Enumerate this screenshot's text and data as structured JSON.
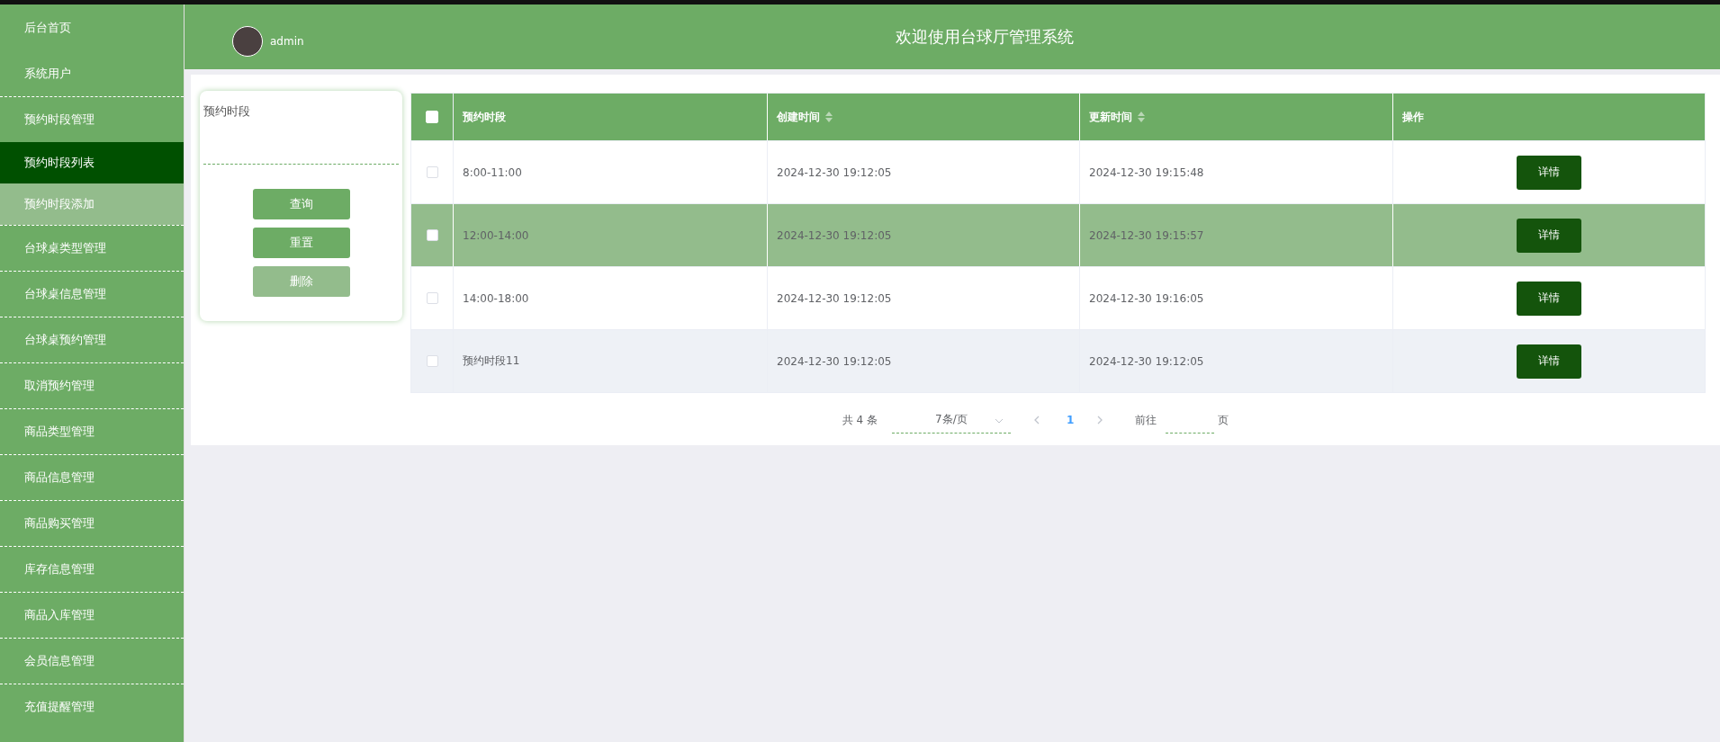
{
  "sidebar": {
    "items": [
      {
        "label": "后台首页",
        "selected": false,
        "hovered": false
      },
      {
        "label": "系统用户",
        "selected": false,
        "hovered": false
      },
      {
        "label": "预约时段管理",
        "selected": false,
        "hovered": false,
        "children": [
          {
            "label": "预约时段列表",
            "selected": true,
            "hovered": false
          },
          {
            "label": "预约时段添加",
            "selected": false,
            "hovered": true
          }
        ]
      },
      {
        "label": "台球桌类型管理",
        "selected": false,
        "hovered": false
      },
      {
        "label": "台球桌信息管理",
        "selected": false,
        "hovered": false
      },
      {
        "label": "台球桌预约管理",
        "selected": false,
        "hovered": false
      },
      {
        "label": "取消预约管理",
        "selected": false,
        "hovered": false
      },
      {
        "label": "商品类型管理",
        "selected": false,
        "hovered": false
      },
      {
        "label": "商品信息管理",
        "selected": false,
        "hovered": false
      },
      {
        "label": "商品购买管理",
        "selected": false,
        "hovered": false
      },
      {
        "label": "库存信息管理",
        "selected": false,
        "hovered": false
      },
      {
        "label": "商品入库管理",
        "selected": false,
        "hovered": false
      },
      {
        "label": "会员信息管理",
        "selected": false,
        "hovered": false
      },
      {
        "label": "充值提醒管理",
        "selected": false,
        "hovered": false
      }
    ]
  },
  "header": {
    "username": "admin",
    "title": "欢迎使用台球厅管理系统"
  },
  "search": {
    "label": "预约时段",
    "buttons": [
      {
        "label": "查询",
        "disabled": false
      },
      {
        "label": "重置",
        "disabled": false
      },
      {
        "label": "删除",
        "disabled": true
      }
    ]
  },
  "table": {
    "select_all": {
      "checked": false
    },
    "columns": [
      {
        "label": "预约时段",
        "kind": "plain"
      },
      {
        "label": "创建时间",
        "kind": "sortable"
      },
      {
        "label": "更新时间",
        "kind": "sortable"
      },
      {
        "label": "操作",
        "kind": "plain"
      }
    ],
    "rows": [
      {
        "checked": false,
        "selected": false,
        "hovered": false,
        "cells": [
          "8:00-11:00",
          "2024-12-30 19:12:05",
          "2024-12-30 19:15:48"
        ],
        "action": "详情"
      },
      {
        "checked": false,
        "selected": true,
        "hovered": false,
        "cells": [
          "12:00-14:00",
          "2024-12-30 19:12:05",
          "2024-12-30 19:15:57"
        ],
        "action": "详情"
      },
      {
        "checked": false,
        "selected": false,
        "hovered": false,
        "cells": [
          "14:00-18:00",
          "2024-12-30 19:12:05",
          "2024-12-30 19:16:05"
        ],
        "action": "详情"
      },
      {
        "checked": false,
        "selected": false,
        "hovered": true,
        "cells": [
          "预约时段11",
          "2024-12-30 19:12:05",
          "2024-12-30 19:12:05"
        ],
        "action": "详情"
      }
    ]
  },
  "pagination": {
    "total": "共 4 条",
    "page_size": "7条/页",
    "pages": [
      {
        "label": "1",
        "selected": true
      }
    ],
    "goto_label": "前往",
    "goto_suffix": "页"
  }
}
